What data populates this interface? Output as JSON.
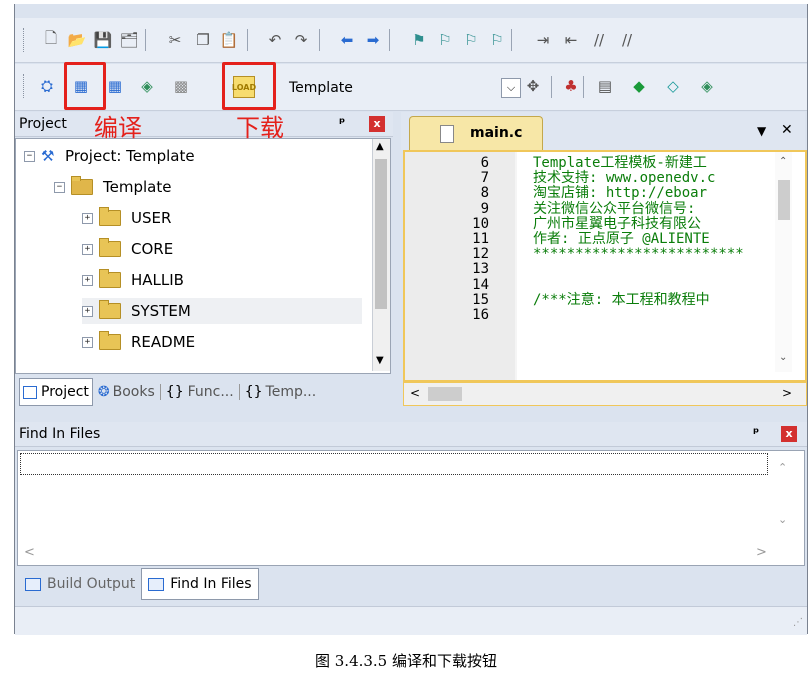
{
  "toolbar1": {
    "icons": [
      "new-file",
      "open-file",
      "save",
      "save-all",
      "cut",
      "copy",
      "paste",
      "undo",
      "redo",
      "nav-back",
      "nav-forward",
      "bookmark",
      "bookmark-prev",
      "bookmark-next",
      "bookmark-clear",
      "indent",
      "unindent",
      "comment",
      "uncomment"
    ]
  },
  "toolbar2": {
    "target_select": "Template",
    "icons": [
      "translate",
      "build",
      "rebuild",
      "batch-build",
      "stop-build",
      "download",
      "target-options",
      "manage-project",
      "manage-components",
      "select-packs",
      "pack-installer",
      "run-env"
    ]
  },
  "annotations": {
    "compile_label": "编译",
    "download_label": "下载"
  },
  "project_panel": {
    "title": "Project",
    "pin": "ᵖ",
    "close": "x",
    "root": "Project: Template",
    "target": "Template",
    "folders": [
      "USER",
      "CORE",
      "HALLIB",
      "SYSTEM",
      "README"
    ],
    "tabs": [
      {
        "label": "Project",
        "icon": "project-icon"
      },
      {
        "label": "Books",
        "icon": "books-icon"
      },
      {
        "label": "Func...",
        "icon": "functions-icon"
      },
      {
        "label": "Temp...",
        "icon": "templates-icon"
      }
    ]
  },
  "editor": {
    "tab_label": "main.c",
    "tab_menu": "▼",
    "tab_close": "✕",
    "lines": [
      {
        "n": "6",
        "text": "Template工程模板-新建工"
      },
      {
        "n": "7",
        "text": "技术支持: www.openedv.c"
      },
      {
        "n": "8",
        "text": "淘宝店铺:  http://eboar"
      },
      {
        "n": "9",
        "text": "关注微信公众平台微信号:"
      },
      {
        "n": "10",
        "text": "广州市星翼电子科技有限公"
      },
      {
        "n": "11",
        "text": "作者: 正点原子 @ALIENTE"
      },
      {
        "n": "12",
        "text": "*************************"
      },
      {
        "n": "13",
        "text": ""
      },
      {
        "n": "14",
        "text": ""
      },
      {
        "n": "15",
        "text": "/***注意: 本工程和教程中"
      },
      {
        "n": "16",
        "text": ""
      }
    ]
  },
  "find_panel": {
    "title": "Find In Files",
    "tabs": [
      {
        "label": "Build Output",
        "icon": "build-output-icon"
      },
      {
        "label": "Find In Files",
        "icon": "find-in-files-icon"
      }
    ]
  },
  "caption": "图 3.4.3.5  编译和下载按钮",
  "colors": {
    "annotation_red": "#e4211b",
    "code_green": "#0a7d0a",
    "folder_yellow": "#e8c456"
  }
}
